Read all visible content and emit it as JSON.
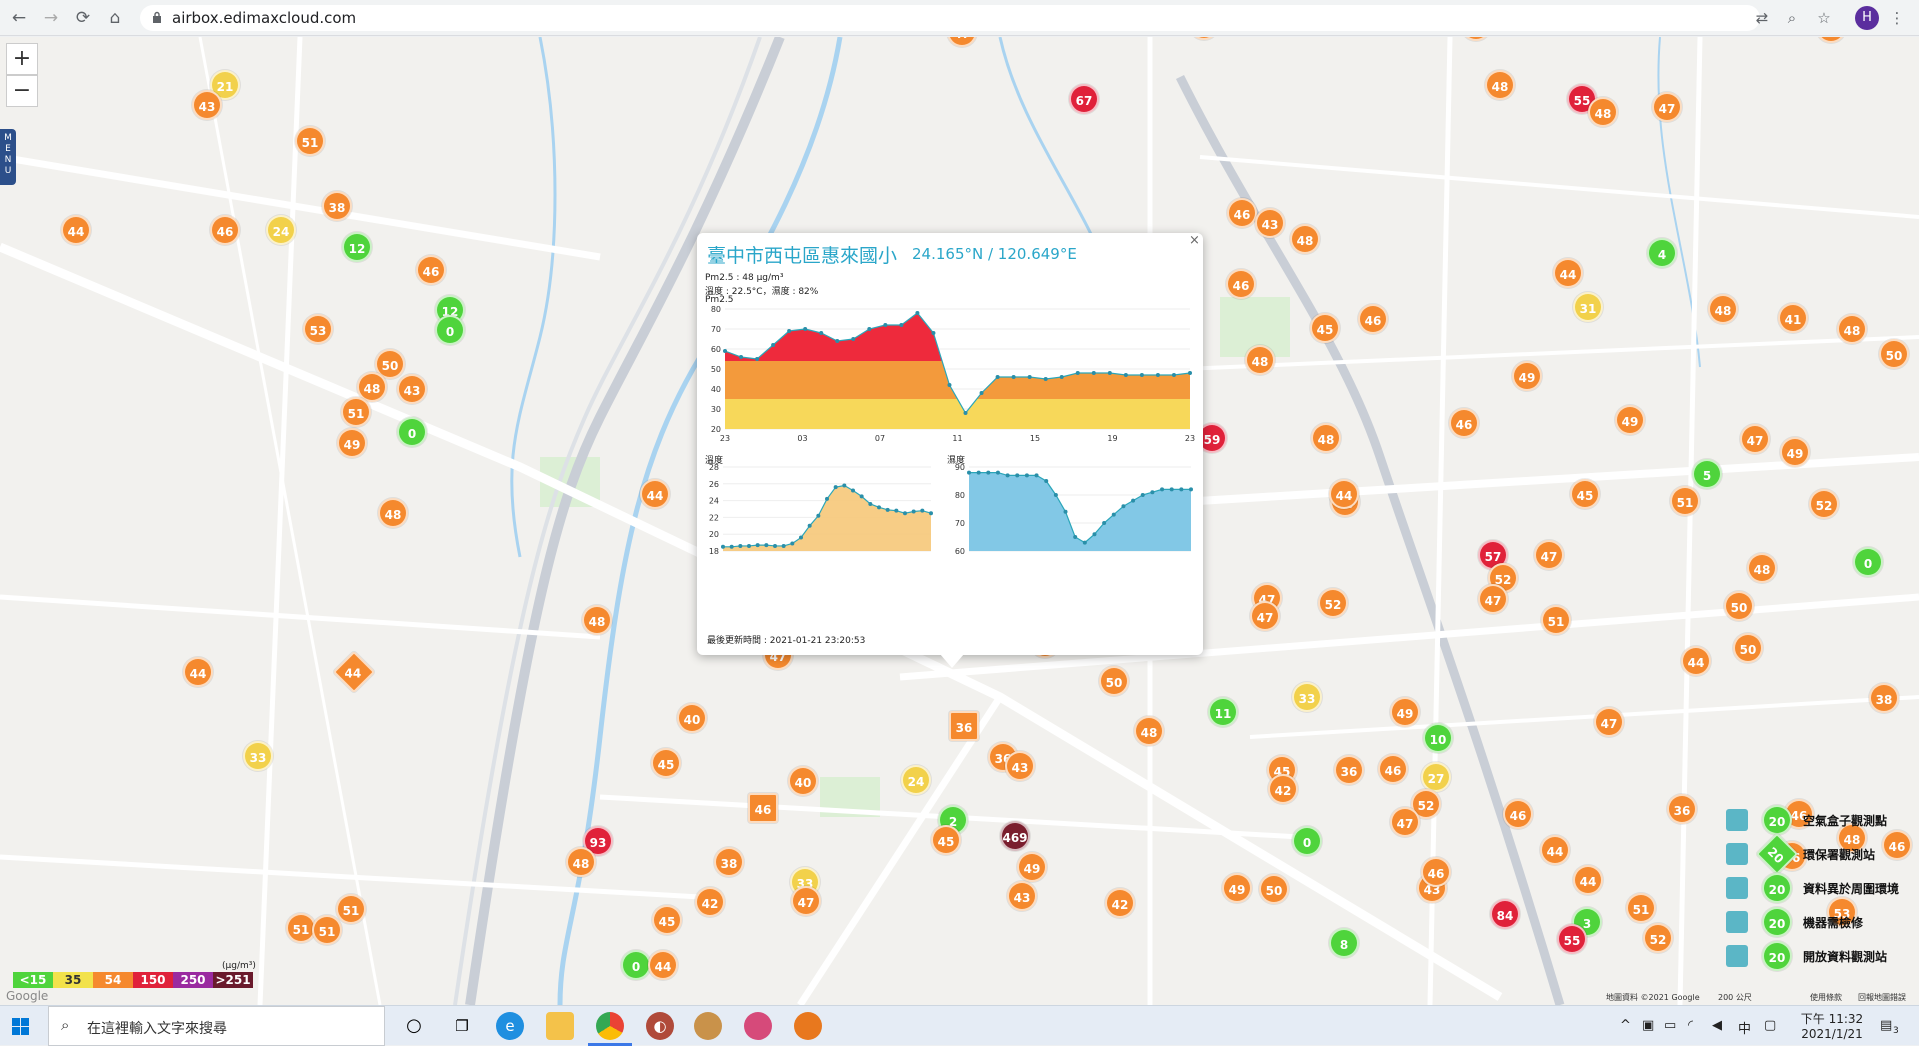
{
  "browser": {
    "url": "airbox.edimaxcloud.com",
    "avatar_letter": "H"
  },
  "map": {
    "zoom_in": "+",
    "zoom_out": "−",
    "menu_letters": "M\nE\nN\nU",
    "attribution": "地圖資料 ©2021 Google",
    "scale_text": "200 公尺",
    "terms": "使用條款",
    "report": "回報地圖錯誤",
    "google_logo": "Google"
  },
  "popup": {
    "title": "臺中市西屯區惠來國小",
    "coords": "24.165°N / 120.649°E",
    "close": "×",
    "pm25_line": "Pm2.5 : 48 μg/m³",
    "temp_humid_line": "溫度 : 22.5°C，濕度 : 82%",
    "pm25_label": "Pm2.5",
    "temp_label": "溫度",
    "humid_label": "濕度",
    "updated": "最後更新時間 : 2021-01-21 23:20:53"
  },
  "chart_data": [
    {
      "type": "area",
      "title": "Pm2.5",
      "x_ticks": [
        "23",
        "03",
        "07",
        "11",
        "15",
        "19",
        "23"
      ],
      "ylim": [
        20,
        80
      ],
      "y_ticks": [
        20,
        30,
        40,
        50,
        60,
        70,
        80
      ],
      "values": [
        59,
        56,
        55,
        62,
        69,
        70,
        68,
        64,
        65,
        70,
        72,
        72,
        78,
        68,
        42,
        28,
        38,
        46,
        46,
        46,
        45,
        46,
        48,
        48,
        48,
        47,
        47,
        47,
        47,
        48
      ]
    },
    {
      "type": "area",
      "title": "溫度",
      "ylim": [
        18,
        28
      ],
      "y_ticks": [
        18,
        20,
        22,
        24,
        26,
        28
      ],
      "values": [
        18.5,
        18.5,
        18.6,
        18.6,
        18.7,
        18.7,
        18.6,
        18.6,
        18.9,
        19.6,
        21,
        22.2,
        24.2,
        25.6,
        25.8,
        25.2,
        24.5,
        23.6,
        23.2,
        22.9,
        22.8,
        22.5,
        22.7,
        22.8,
        22.5
      ]
    },
    {
      "type": "area",
      "title": "濕度",
      "ylim": [
        60,
        90
      ],
      "y_ticks": [
        60,
        70,
        80,
        90
      ],
      "values": [
        88,
        88,
        88,
        88,
        87,
        87,
        87,
        87,
        85,
        80,
        74,
        65,
        63,
        66,
        70,
        73,
        76,
        78,
        80,
        81,
        82,
        82,
        82,
        82
      ]
    }
  ],
  "markers": [
    {
      "v": "46",
      "c": "or"
    },
    {
      "v": "21",
      "c": "ye"
    },
    {
      "v": "43",
      "c": "or"
    },
    {
      "v": "51",
      "c": "or"
    },
    {
      "v": "44",
      "c": "or"
    },
    {
      "v": "46",
      "c": "or"
    },
    {
      "v": "24",
      "c": "ye"
    },
    {
      "v": "38",
      "c": "or"
    },
    {
      "v": "12",
      "c": "gr"
    },
    {
      "v": "46",
      "c": "or"
    },
    {
      "v": "12",
      "c": "gr"
    },
    {
      "v": "0",
      "c": "gr"
    },
    {
      "v": "53",
      "c": "or"
    },
    {
      "v": "50",
      "c": "or"
    },
    {
      "v": "48",
      "c": "or"
    },
    {
      "v": "43",
      "c": "or"
    },
    {
      "v": "51",
      "c": "or"
    },
    {
      "v": "49",
      "c": "or"
    },
    {
      "v": "0",
      "c": "gr"
    },
    {
      "v": "48",
      "c": "or"
    },
    {
      "v": "47",
      "c": "or"
    },
    {
      "v": "67",
      "c": "rd"
    },
    {
      "v": "47",
      "c": "or"
    },
    {
      "v": "49",
      "c": "or"
    },
    {
      "v": "48",
      "c": "or"
    },
    {
      "v": "55",
      "c": "rd"
    },
    {
      "v": "48",
      "c": "or"
    },
    {
      "v": "47",
      "c": "or"
    },
    {
      "v": "45",
      "c": "or"
    },
    {
      "v": "46",
      "c": "or"
    },
    {
      "v": "43",
      "c": "or"
    },
    {
      "v": "48",
      "c": "or"
    },
    {
      "v": "46",
      "c": "or"
    },
    {
      "v": "45",
      "c": "or"
    },
    {
      "v": "46",
      "c": "or"
    },
    {
      "v": "44",
      "c": "or"
    },
    {
      "v": "4",
      "c": "gr"
    },
    {
      "v": "31",
      "c": "ye"
    },
    {
      "v": "48",
      "c": "or"
    },
    {
      "v": "41",
      "c": "or"
    },
    {
      "v": "48",
      "c": "or"
    },
    {
      "v": "50",
      "c": "or"
    },
    {
      "v": "48",
      "c": "or"
    },
    {
      "v": "49",
      "c": "or"
    },
    {
      "v": "46",
      "c": "or"
    },
    {
      "v": "49",
      "c": "or"
    },
    {
      "v": "47",
      "c": "or"
    },
    {
      "v": "45",
      "c": "or"
    },
    {
      "v": "5",
      "c": "gr"
    },
    {
      "v": "49",
      "c": "or"
    },
    {
      "v": "59",
      "c": "rd"
    },
    {
      "v": "48",
      "c": "or"
    },
    {
      "v": "48",
      "c": "or"
    },
    {
      "v": "44",
      "c": "or"
    },
    {
      "v": "51",
      "c": "or"
    },
    {
      "v": "52",
      "c": "or"
    },
    {
      "v": "57",
      "c": "rd"
    },
    {
      "v": "52",
      "c": "or"
    },
    {
      "v": "47",
      "c": "or"
    },
    {
      "v": "47",
      "c": "or"
    },
    {
      "v": "48",
      "c": "or"
    },
    {
      "v": "0",
      "c": "gr"
    },
    {
      "v": "47",
      "c": "or"
    },
    {
      "v": "52",
      "c": "or"
    },
    {
      "v": "51",
      "c": "or"
    },
    {
      "v": "50",
      "c": "or"
    },
    {
      "v": "44",
      "c": "or"
    },
    {
      "v": "50",
      "c": "or"
    },
    {
      "v": "38",
      "c": "or"
    },
    {
      "v": "44",
      "c": "or"
    },
    {
      "v": "48",
      "c": "or"
    },
    {
      "v": "47",
      "c": "or"
    },
    {
      "v": "51",
      "c": "or"
    },
    {
      "v": "50",
      "c": "or"
    },
    {
      "v": "47",
      "c": "or"
    },
    {
      "v": "11",
      "c": "gr"
    },
    {
      "v": "33",
      "c": "ye"
    },
    {
      "v": "49",
      "c": "or"
    },
    {
      "v": "10",
      "c": "gr"
    },
    {
      "v": "47",
      "c": "or"
    },
    {
      "v": "40",
      "c": "or"
    },
    {
      "v": "45",
      "c": "or"
    },
    {
      "v": "36",
      "c": "or"
    },
    {
      "v": "48",
      "c": "or"
    },
    {
      "v": "43",
      "c": "or"
    },
    {
      "v": "45",
      "c": "or"
    },
    {
      "v": "36",
      "c": "or"
    },
    {
      "v": "46",
      "c": "or"
    },
    {
      "v": "27",
      "c": "ye"
    },
    {
      "v": "42",
      "c": "or"
    },
    {
      "v": "52",
      "c": "or"
    },
    {
      "v": "47",
      "c": "or"
    },
    {
      "v": "46",
      "c": "or"
    },
    {
      "v": "36",
      "c": "or"
    },
    {
      "v": "46",
      "c": "or"
    },
    {
      "v": "46",
      "c": "or"
    },
    {
      "v": "40",
      "c": "or"
    },
    {
      "v": "24",
      "c": "ye"
    },
    {
      "v": "2",
      "c": "gr"
    },
    {
      "v": "45",
      "c": "or"
    },
    {
      "v": "469",
      "c": "pu"
    },
    {
      "v": "49",
      "c": "or"
    },
    {
      "v": "43",
      "c": "or"
    },
    {
      "v": "0",
      "c": "gr"
    },
    {
      "v": "93",
      "c": "rd"
    },
    {
      "v": "48",
      "c": "or"
    },
    {
      "v": "38",
      "c": "or"
    },
    {
      "v": "33",
      "c": "ye"
    },
    {
      "v": "47",
      "c": "or"
    },
    {
      "v": "42",
      "c": "or"
    },
    {
      "v": "45",
      "c": "or"
    },
    {
      "v": "42",
      "c": "or"
    },
    {
      "v": "49",
      "c": "or"
    },
    {
      "v": "50",
      "c": "or"
    },
    {
      "v": "43",
      "c": "or"
    },
    {
      "v": "46",
      "c": "or"
    },
    {
      "v": "44",
      "c": "or"
    },
    {
      "v": "84",
      "c": "rd"
    },
    {
      "v": "3",
      "c": "gr"
    },
    {
      "v": "55",
      "c": "rd"
    },
    {
      "v": "51",
      "c": "or"
    },
    {
      "v": "52",
      "c": "or"
    },
    {
      "v": "53",
      "c": "or"
    },
    {
      "v": "8",
      "c": "gr"
    },
    {
      "v": "51",
      "c": "or"
    },
    {
      "v": "51",
      "c": "or"
    },
    {
      "v": "33",
      "c": "ye"
    },
    {
      "v": "44",
      "c": "or"
    },
    {
      "v": "51",
      "c": "or"
    },
    {
      "v": "46",
      "c": "or"
    },
    {
      "v": "0",
      "c": "gr"
    },
    {
      "v": "44",
      "c": "or"
    },
    {
      "v": "44",
      "c": "or"
    },
    {
      "v": "48",
      "c": "or"
    }
  ],
  "special_markers": {
    "square_36": "36",
    "square_46": "46",
    "diamond_44": "44",
    "selected_48": "48"
  },
  "legend": {
    "items": [
      {
        "label": "空氣盒子觀測點",
        "badge": "20"
      },
      {
        "label": "環保署觀測站",
        "badge": "20"
      },
      {
        "label": "資料異於周圍環境",
        "badge": "20"
      },
      {
        "label": "機器需檢修",
        "badge": "20"
      },
      {
        "label": "開放資料觀測站",
        "badge": "20"
      }
    ]
  },
  "scale": {
    "unit": "(μg/m³)",
    "bands": [
      {
        "label": "<15",
        "color": "#4fd43c"
      },
      {
        "label": "35",
        "color": "#f2e24b"
      },
      {
        "label": "54",
        "color": "#f5892e"
      },
      {
        "label": "150",
        "color": "#e0213a"
      },
      {
        "label": "250",
        "color": "#9a2aa0"
      },
      {
        "label": ">251",
        "color": "#6a1a2c"
      }
    ]
  },
  "taskbar": {
    "search_placeholder": "在這裡輸入文字來搜尋",
    "time": "下午 11:32",
    "date": "2021/1/21",
    "ime": "中",
    "notif_count": "3"
  }
}
